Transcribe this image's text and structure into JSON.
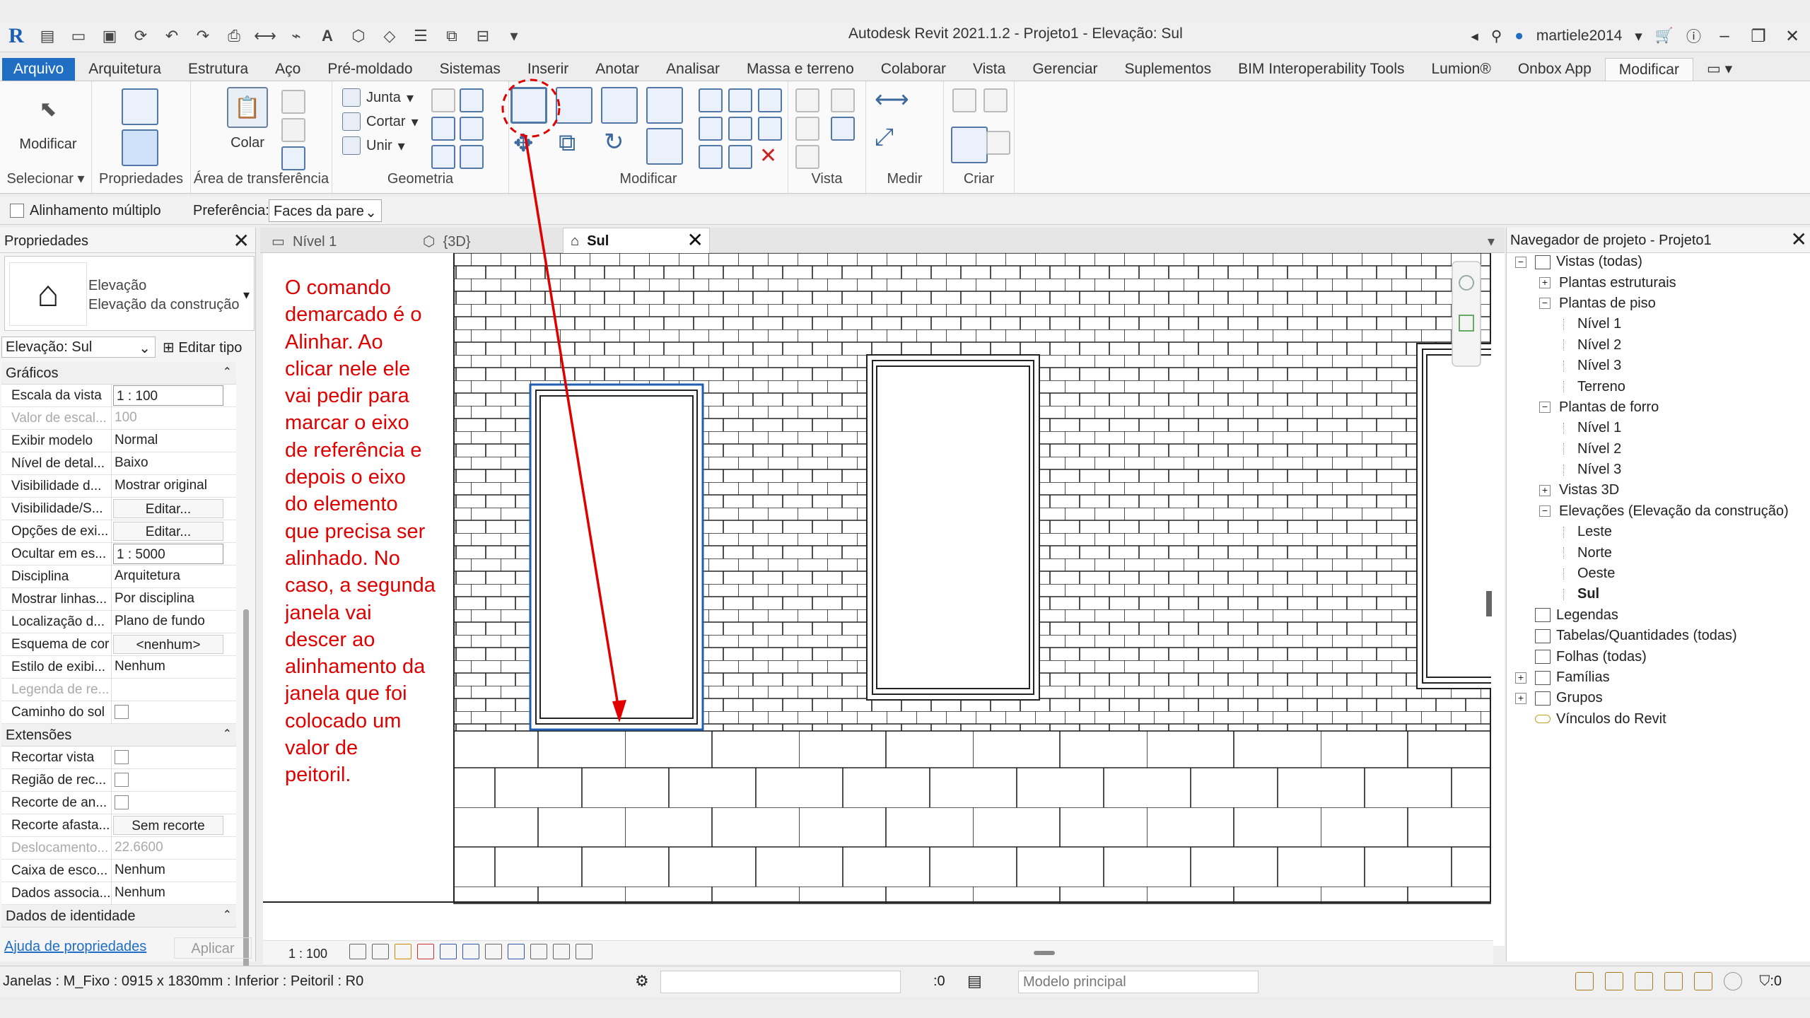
{
  "window": {
    "title": "Autodesk Revit 2021.1.2 - Projeto1 - Elevação: Sul",
    "user": "martiele2014"
  },
  "tabs": [
    {
      "label": "Arquivo"
    },
    {
      "label": "Arquitetura"
    },
    {
      "label": "Estrutura"
    },
    {
      "label": "Aço"
    },
    {
      "label": "Pré-moldado"
    },
    {
      "label": "Sistemas"
    },
    {
      "label": "Inserir"
    },
    {
      "label": "Anotar"
    },
    {
      "label": "Analisar"
    },
    {
      "label": "Massa e terreno"
    },
    {
      "label": "Colaborar"
    },
    {
      "label": "Vista"
    },
    {
      "label": "Gerenciar"
    },
    {
      "label": "Suplementos"
    },
    {
      "label": "BIM Interoperability Tools"
    },
    {
      "label": "Lumion®"
    },
    {
      "label": "Onbox App"
    },
    {
      "label": "Modificar"
    }
  ],
  "ribbon": {
    "modify_label": "Modificar",
    "paste_label": "Colar",
    "join_label": "Junta",
    "cut_label": "Cortar",
    "unite_label": "Unir",
    "panels": {
      "select": "Selecionar",
      "properties": "Propriedades",
      "clipboard": "Área de transferência",
      "geometry": "Geometria",
      "modify": "Modificar",
      "view": "Vista",
      "measure": "Medir",
      "create": "Criar"
    }
  },
  "options_bar": {
    "multi_align_label": "Alinhamento múltiplo",
    "preference_label": "Preferência:",
    "preference_value": "Faces da pare"
  },
  "properties": {
    "header": "Propriedades",
    "type_line1": "Elevação",
    "type_line2": "Elevação da construção",
    "view_selector": "Elevação: Sul",
    "edit_type": "Editar tipo",
    "groups": {
      "graphics": "Gráficos",
      "extents": "Extensões",
      "identity": "Dados de identidade"
    },
    "graphics_rows": [
      {
        "k": "Escala da vista",
        "v": "1 : 100"
      },
      {
        "k": "Valor de escal...",
        "v": "100"
      },
      {
        "k": "Exibir modelo",
        "v": "Normal"
      },
      {
        "k": "Nível de detal...",
        "v": "Baixo"
      },
      {
        "k": "Visibilidade d...",
        "v": "Mostrar original"
      },
      {
        "k": "Visibilidade/S...",
        "v": "Editar..."
      },
      {
        "k": "Opções de exi...",
        "v": "Editar..."
      },
      {
        "k": "Ocultar em es...",
        "v": "1 : 5000"
      },
      {
        "k": "Disciplina",
        "v": "Arquitetura"
      },
      {
        "k": "Mostrar linhas...",
        "v": "Por disciplina"
      },
      {
        "k": "Localização d...",
        "v": "Plano de fundo"
      },
      {
        "k": "Esquema de cor",
        "v": "<nenhum>"
      },
      {
        "k": "Estilo de exibi...",
        "v": "Nenhum"
      },
      {
        "k": "Legenda de re...",
        "v": ""
      },
      {
        "k": "Caminho do sol",
        "v": ""
      }
    ],
    "extents_rows": [
      {
        "k": "Recortar vista",
        "v": ""
      },
      {
        "k": "Região de rec...",
        "v": ""
      },
      {
        "k": "Recorte de an...",
        "v": ""
      },
      {
        "k": "Recorte afasta...",
        "v": "Sem recorte"
      },
      {
        "k": "Deslocamento...",
        "v": "22.6600"
      },
      {
        "k": "Caixa de esco...",
        "v": "Nenhum"
      },
      {
        "k": "Dados associa...",
        "v": "Nenhum"
      }
    ],
    "help_link": "Ajuda de propriedades",
    "apply": "Aplicar"
  },
  "view_tabs": [
    {
      "label": "Nível 1"
    },
    {
      "label": "{3D}"
    },
    {
      "label": "Sul"
    }
  ],
  "annotation": "O comando\ndemarcado é o\nAlinhar. Ao\nclicar nele ele\nvai pedir para\nmarcar o eixo\nde referência e\ndepois o eixo\ndo elemento\nque precisa ser\nalinhado. No\ncaso, a segunda\njanela vai\ndescer ao\nalinhamento da\njanela que foi\ncolocado um\nvalor de\npeitoril.",
  "view_scale": "1 : 100",
  "browser": {
    "header": "Navegador de projeto - Projeto1",
    "items": [
      {
        "label": "Vistas (todas)"
      },
      {
        "label": "Plantas estruturais"
      },
      {
        "label": "Plantas de piso"
      },
      {
        "label": "Nível 1"
      },
      {
        "label": "Nível 2"
      },
      {
        "label": "Nível 3"
      },
      {
        "label": "Terreno"
      },
      {
        "label": "Plantas de forro"
      },
      {
        "label": "Nível 1"
      },
      {
        "label": "Nível 2"
      },
      {
        "label": "Nível 3"
      },
      {
        "label": "Vistas 3D"
      },
      {
        "label": "Elevações (Elevação da construção)"
      },
      {
        "label": "Leste"
      },
      {
        "label": "Norte"
      },
      {
        "label": "Oeste"
      },
      {
        "label": "Sul"
      },
      {
        "label": "Legendas"
      },
      {
        "label": "Tabelas/Quantidades (todas)"
      },
      {
        "label": "Folhas (todas)"
      },
      {
        "label": "Famílias"
      },
      {
        "label": "Grupos"
      },
      {
        "label": "Vínculos do Revit"
      }
    ]
  },
  "status": {
    "message": "Janelas : M_Fixo : 0915 x 1830mm : Inferior : Peitoril : R0",
    "count": ":0",
    "model": "Modelo principal",
    "filter": ":0"
  },
  "colors": {
    "accent": "#1f6ec4",
    "annotation": "#e00000"
  }
}
